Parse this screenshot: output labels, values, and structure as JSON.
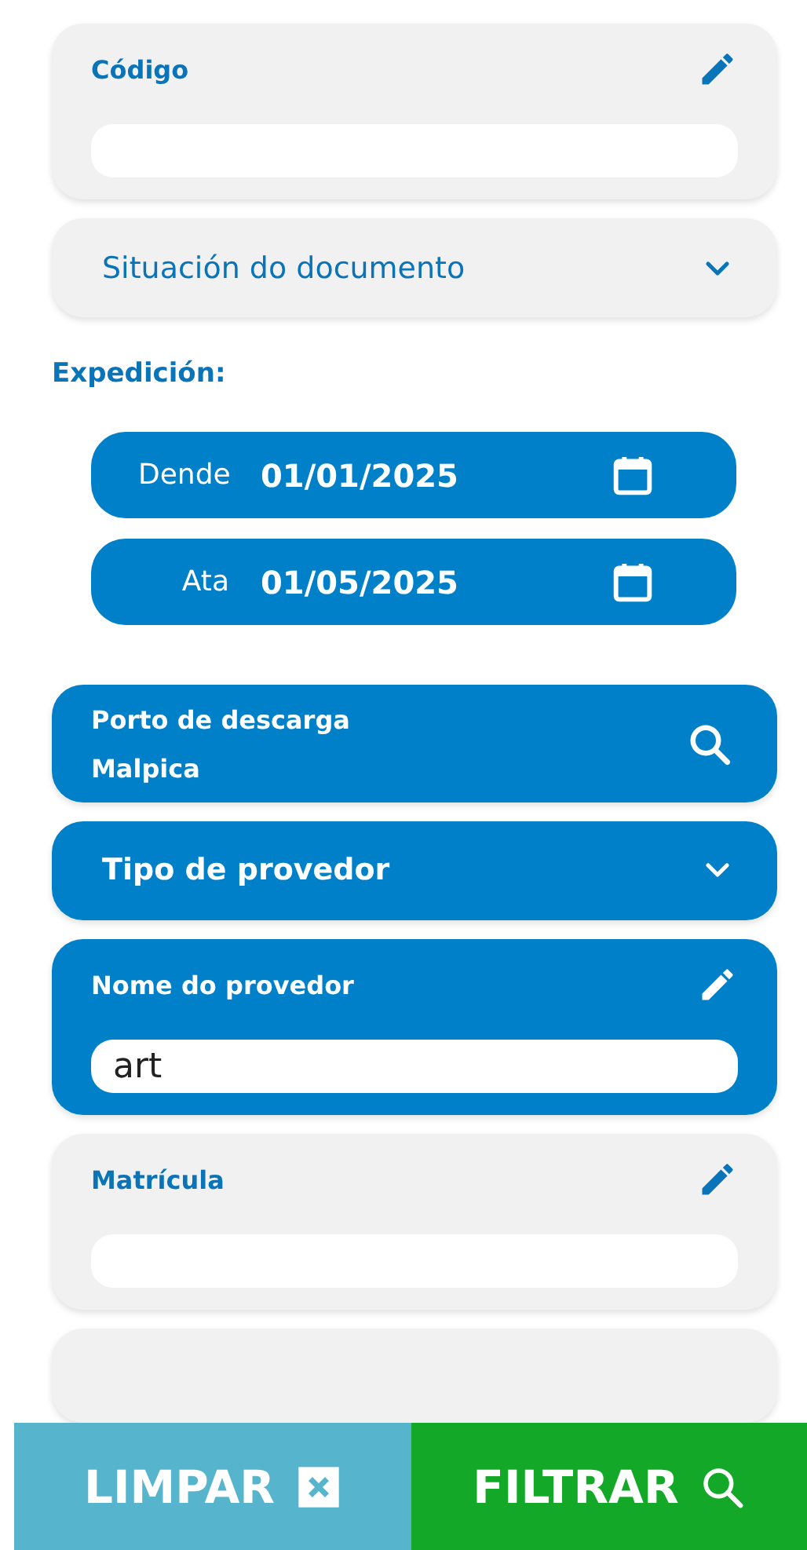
{
  "filters": [
    {
      "kind": "text",
      "label": "Código",
      "active": false
    },
    {
      "kind": "dropdown",
      "label": "Situación do documento",
      "active": false
    },
    {
      "kind": "daterange",
      "label": "Expedición:",
      "ranges": [
        {
          "label": "Dende",
          "value": "01/01/2025"
        },
        {
          "label": "Ata",
          "value": "01/05/2025"
        }
      ]
    },
    {
      "kind": "search",
      "label": "Porto de descarga",
      "active": true,
      "value": "Malpica"
    },
    {
      "kind": "dropdown",
      "label": "Tipo de provedor",
      "active": true
    },
    {
      "kind": "text",
      "label": "Nome do provedor",
      "active": true,
      "value": "art"
    },
    {
      "kind": "text",
      "label": "Matrícula",
      "active": false
    }
  ],
  "buttons": [
    {
      "kind": "clear",
      "label": "LIMPAR"
    },
    {
      "kind": "filter",
      "label": "FILTRAR"
    }
  ]
}
